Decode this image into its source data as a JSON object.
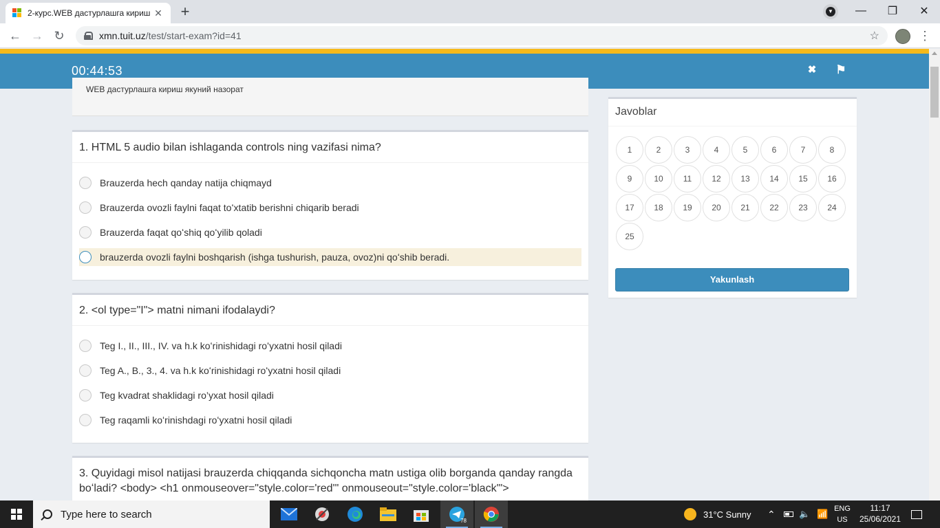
{
  "browser": {
    "tab_title": "2-курс.WEB дастурлашга кириш",
    "tab_close": "✕",
    "new_tab": "+",
    "url_host": "xmn.tuit.uz",
    "url_path": "/test/start-exam?id=41",
    "back": "←",
    "forward": "→",
    "reload": "↻",
    "bookmark": "☆",
    "menu": "⋮",
    "win_minimize": "—",
    "win_restore": "❐",
    "win_close": "✕"
  },
  "exam": {
    "timer": "00:44:53",
    "close_icon": "✖",
    "flag_icon": "⚑",
    "course_title": "WEB дастурлашга кириш якуний назорат"
  },
  "questions": [
    {
      "text": "1. HTML 5 audio bilan ishlaganda controls ning vazifasi nima?",
      "options": [
        "Brauzerda hech qanday natija chiqmayd",
        "Brauzerda ovozli faylni faqat toʻxtatib berishni chiqarib beradi",
        "Brauzerda faqat qoʻshiq qoʻyilib qoladi",
        "brauzerda ovozli faylni boshqarish (ishga tushurish, pauza, ovoz)ni qoʻshib beradi."
      ],
      "selected_index": 3
    },
    {
      "text": "2. <ol type=\"I\"> matni nimani ifodalaydi?",
      "options": [
        "Teg I., II., III., IV. va h.k koʻrinishidagi roʻyxatni hosil qiladi",
        "Teg A., B., 3., 4. va h.k koʻrinishidagi roʻyxatni hosil qiladi",
        "Teg kvadrat shaklidagi ro’yxat hosil qiladi",
        "Teg raqamli koʻrinishdagi roʻyxatni hosil qiladi"
      ],
      "selected_index": -1
    },
    {
      "text": "3. Quyidagi misol natijasi brauzerda chiqqanda sichqoncha matn ustiga olib borganda qanday rangda boʻladi? <body> <h1 onmouseover=\"style.color='red'\" onmouseout=\"style.color='black'\">"
    }
  ],
  "answers_panel": {
    "title": "Javoblar",
    "numbers": [
      "1",
      "2",
      "3",
      "4",
      "5",
      "6",
      "7",
      "8",
      "9",
      "10",
      "11",
      "12",
      "13",
      "14",
      "15",
      "16",
      "17",
      "18",
      "19",
      "20",
      "21",
      "22",
      "23",
      "24",
      "25"
    ],
    "finish_label": "Yakunlash"
  },
  "taskbar": {
    "search_placeholder": "Type here to search",
    "weather": "31°C  Sunny",
    "lang_1": "ENG",
    "lang_2": "US",
    "time": "11:17",
    "date": "25/06/2021",
    "telegram_badge": "78"
  },
  "colors": {
    "accent_bar": "#f6b91a",
    "primary": "#3c8dbc",
    "selected_option_bg": "#f7f0dd"
  }
}
